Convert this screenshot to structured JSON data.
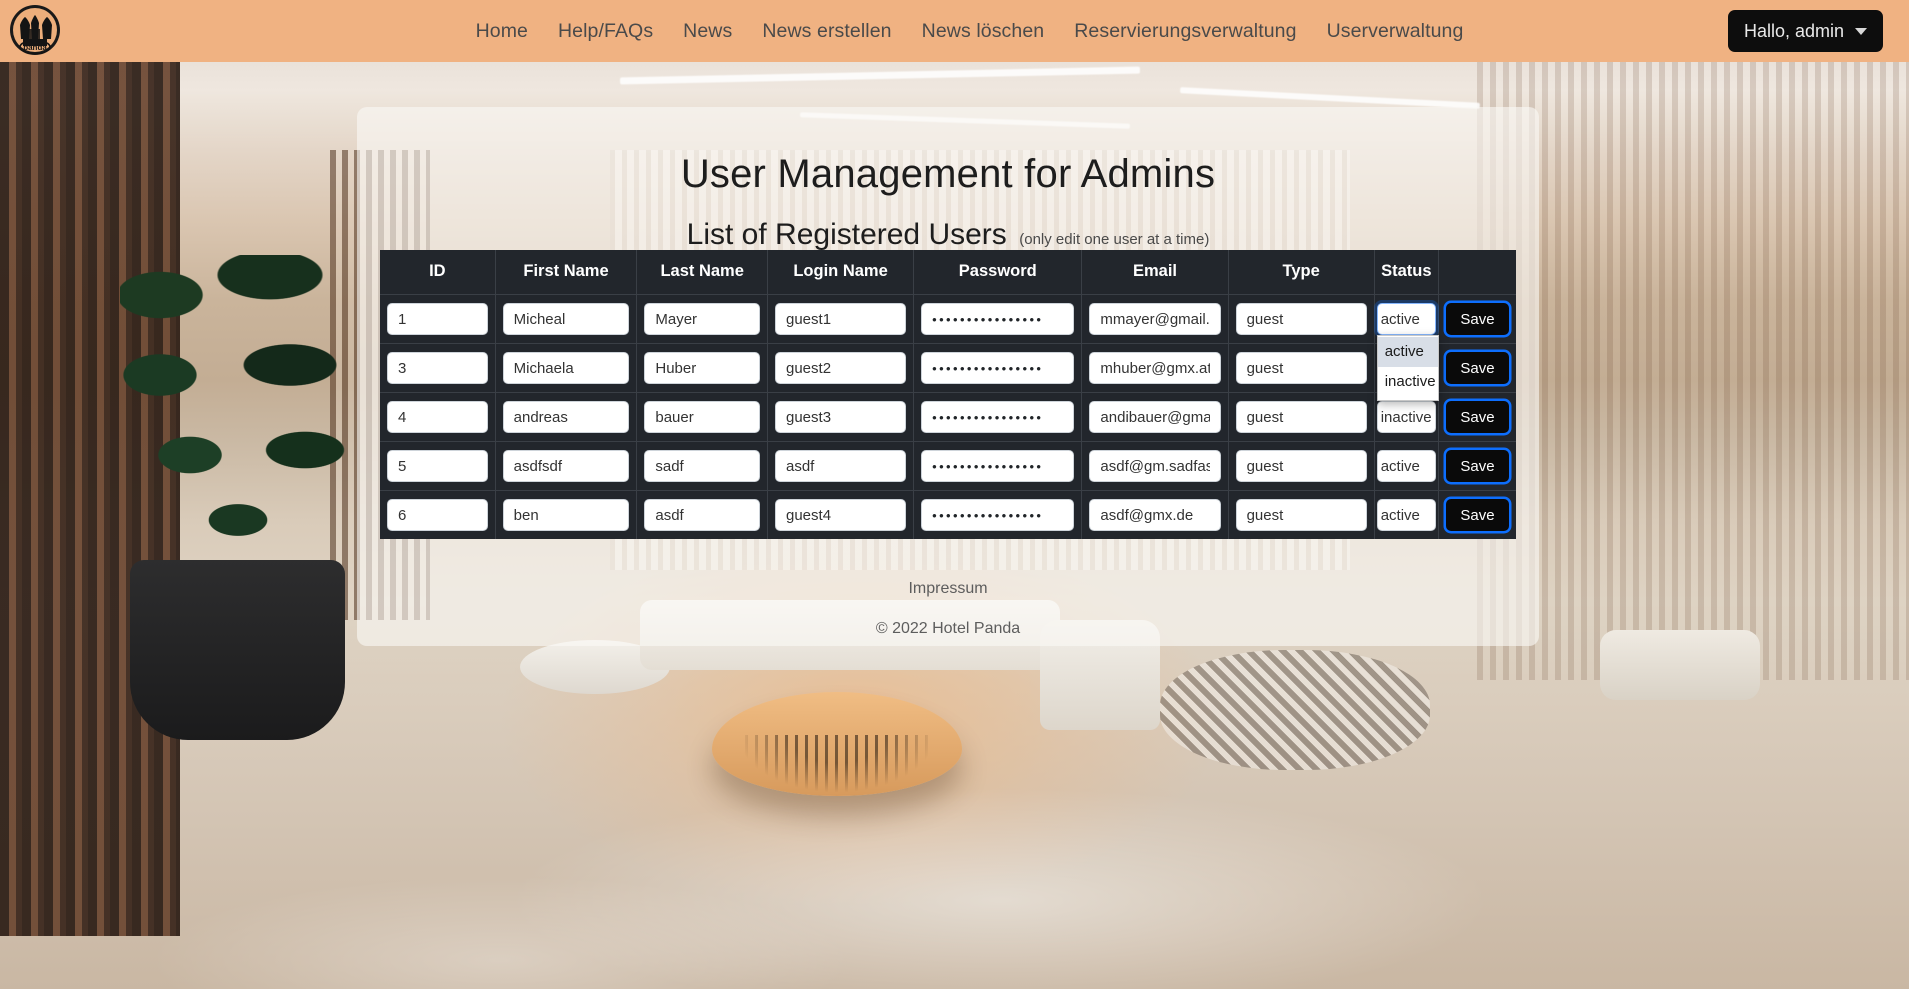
{
  "navbar": {
    "brand_name": "panda-logo",
    "brand_text": "panda",
    "links": [
      {
        "label": "Home"
      },
      {
        "label": "Help/FAQs"
      },
      {
        "label": "News"
      },
      {
        "label": "News erstellen"
      },
      {
        "label": "News löschen"
      },
      {
        "label": "Reservierungsverwaltung"
      },
      {
        "label": "Userverwaltung"
      }
    ],
    "user_button": "Hallo, admin",
    "background_color": "#f0b282"
  },
  "page": {
    "title": "User Management for Admins",
    "subtitle": "List of Registered Users",
    "subtitle_note": "(only edit one user at a time)"
  },
  "table": {
    "headers": [
      "ID",
      "First Name",
      "Last Name",
      "Login Name",
      "Password",
      "Email",
      "Type",
      "Status",
      ""
    ],
    "save_label": "Save",
    "password_mask": "••••••••••••••••",
    "rows": [
      {
        "id": "1",
        "first_name": "Micheal",
        "last_name": "Mayer",
        "login_name": "guest1",
        "password": "••••••••••••••••",
        "email": "mmayer@gmail.c",
        "type": "guest",
        "status": "active"
      },
      {
        "id": "3",
        "first_name": "Michaela",
        "last_name": "Huber",
        "login_name": "guest2",
        "password": "••••••••••••••••",
        "email": "mhuber@gmx.at",
        "type": "guest",
        "status": "active"
      },
      {
        "id": "4",
        "first_name": "andreas",
        "last_name": "bauer",
        "login_name": "guest3",
        "password": "••••••••••••••••",
        "email": "andibauer@gmai",
        "type": "guest",
        "status": "inactive"
      },
      {
        "id": "5",
        "first_name": "asdfsdf",
        "last_name": "sadf",
        "login_name": "asdf",
        "password": "••••••••••••••••",
        "email": "asdf@gm.sadfasc",
        "type": "guest",
        "status": "active"
      },
      {
        "id": "6",
        "first_name": "ben",
        "last_name": "asdf",
        "login_name": "guest4",
        "password": "••••••••••••••••",
        "email": "asdf@gmx.de",
        "type": "guest",
        "status": "active"
      }
    ]
  },
  "status_dropdown": {
    "open_on_row": 0,
    "options": [
      {
        "label": "active",
        "selected": true
      },
      {
        "label": "inactive",
        "selected": false
      }
    ]
  },
  "footer": {
    "impressum": "Impressum",
    "copyright": "© 2022 Hotel Panda"
  },
  "colors": {
    "nav": "#f0b282",
    "table_bg": "#22262c",
    "save_bg": "#0a0a0a",
    "focus_blue": "#0d6efd"
  }
}
